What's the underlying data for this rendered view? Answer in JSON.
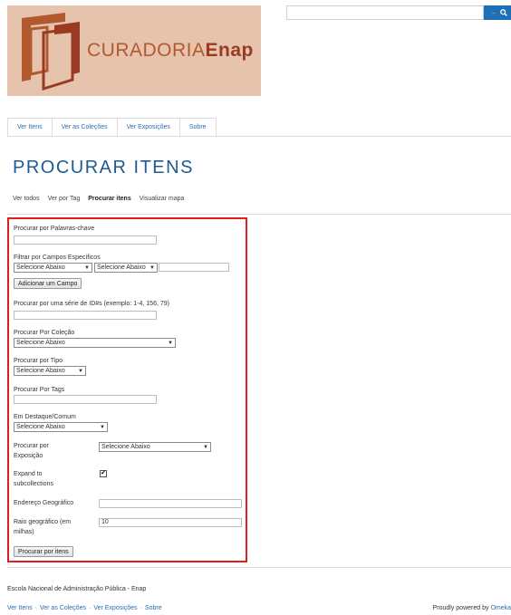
{
  "logo": {
    "text_part1": "CURADORIA",
    "text_part2": "Enap",
    "background": "#e6c3ad"
  },
  "search": {
    "value": "",
    "button_dots": "...",
    "icon": "search-icon"
  },
  "nav": {
    "tabs": [
      "Ver Itens",
      "Ver as Coleções",
      "Ver Exposições",
      "Sobre"
    ]
  },
  "page": {
    "title": "PROCURAR ITENS"
  },
  "subnav": {
    "items": [
      "Ver todos",
      "Ver por Tag",
      "Procurar itens",
      "Visualizar mapa"
    ],
    "active": "Procurar itens"
  },
  "form": {
    "keywords_label": "Procurar por Palavras-chave",
    "keywords_value": "",
    "fields_label": "Filtrar por Campos Específicos",
    "field_select": "Selecione Abaixo",
    "field_type_select": "Selecione Abaixo",
    "field_value": "",
    "add_field_button": "Adicionar um Campo",
    "ids_label": "Procurar por uma série de ID#s (exemplo: 1-4, 156, 79)",
    "ids_value": "",
    "collection_label": "Procurar Por Coleção",
    "collection_select": "Selecione Abaixo",
    "type_label": "Procurar por Tipo",
    "type_select": "Selecione Abaixo",
    "tags_label": "Procurar Por Tags",
    "tags_value": "",
    "featured_label": "Em Destaque/Comum",
    "featured_select": "Selecione Abaixo",
    "exhibit_label_1": "Procurar por",
    "exhibit_label_2": "Exposição",
    "exhibit_select": "Selecione Abaixo",
    "subcollections_label_1": "Expand to",
    "subcollections_label_2": "subcollections",
    "subcollections_checked": true,
    "geo_address_label": "Endereço Geográfico",
    "geo_address_value": "",
    "geo_radius_label_1": "Raio geográfico (em",
    "geo_radius_label_2": "milhas)",
    "geo_radius_value": "10",
    "submit_button": "Procurar por itens",
    "accent": "#e11d1d"
  },
  "footer": {
    "org": "Escola Nacional de Administração Pública - Enap",
    "nav": [
      "Ver Itens",
      "Ver as Coleções",
      "Ver Exposições",
      "Sobre"
    ],
    "powered_prefix": "Proudly powered by",
    "powered_link": "Omeka"
  },
  "colors": {
    "link": "#2b6cb0",
    "title": "#1f5a93",
    "search_button": "#1f6fb6"
  }
}
